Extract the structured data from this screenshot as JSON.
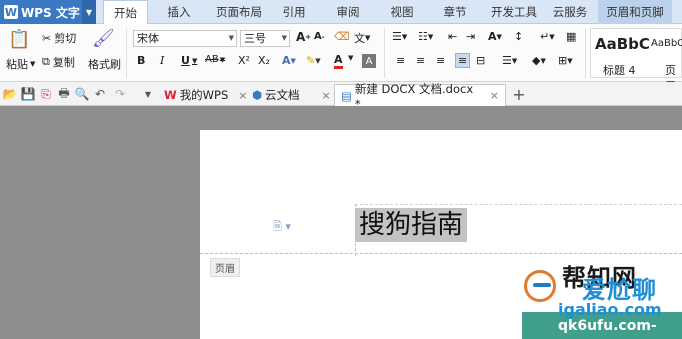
{
  "app": {
    "name": "WPS 文字",
    "logo_letter": "W"
  },
  "menu": {
    "tabs": [
      "开始",
      "插入",
      "页面布局",
      "引用",
      "审阅",
      "视图",
      "章节",
      "开发工具",
      "云服务",
      "页眉和页脚"
    ]
  },
  "ribbon": {
    "paste_label": "粘贴",
    "cut_label": "剪切",
    "copy_label": "复制",
    "format_painter_label": "格式刷",
    "font_name": "宋体",
    "font_size": "三号",
    "bold": "B",
    "italic": "I",
    "underline": "U",
    "strike": "AB",
    "superscript": "X²",
    "subscript": "X₂",
    "grow_font": "A",
    "shrink_font": "A",
    "style_preview_1": "AaBbC",
    "style_preview_2": "AaBbC",
    "style_name_1": "标题 4",
    "style_name_2": "页眉"
  },
  "doc_tabs": {
    "tabs": [
      {
        "label": "我的WPS",
        "icon": "wps-home-icon"
      },
      {
        "label": "云文档",
        "icon": "cloud-doc-icon"
      },
      {
        "label": "新建 DOCX 文档.docx *",
        "icon": "docx-icon"
      }
    ],
    "add_label": "+"
  },
  "document": {
    "header_text": "搜狗指南",
    "header_tag": "页眉"
  },
  "watermark": {
    "brand_top": "帮知网",
    "brand_main": "爱尬聊",
    "url": "igaliao.com",
    "sub": "qk6ufu.com-"
  },
  "colors": {
    "app_blue": "#3b78c4",
    "menu_bg": "#d8e6f5",
    "selection": "#c3c3c3",
    "workspace": "#8d8d8d"
  }
}
